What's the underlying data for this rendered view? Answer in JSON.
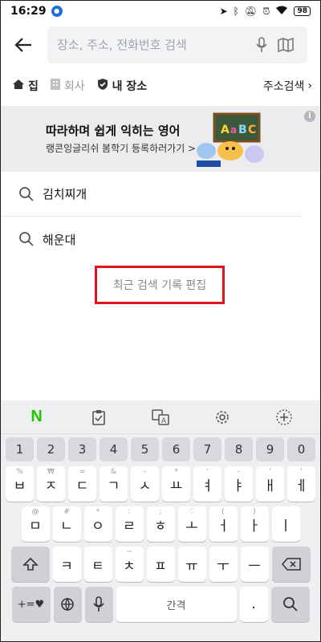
{
  "status_bar": {
    "time": "16:29",
    "battery": "98"
  },
  "search": {
    "placeholder": "장소, 주소, 전화번호 검색"
  },
  "tabs": {
    "home": "집",
    "work": "회사",
    "my_places": "내 장소",
    "address_search": "주소검색"
  },
  "ad": {
    "title": "따라하며 쉽게 익히는 영어",
    "subtitle": "랭콘잉글리쉬 봄학기 등록하러가기 >",
    "info": "i"
  },
  "recent_searches": [
    {
      "label": "김치찌개"
    },
    {
      "label": "해운대"
    }
  ],
  "edit_history_label": "최근 검색 기록 편집",
  "keyboard": {
    "number_row": [
      "1",
      "2",
      "3",
      "4",
      "5",
      "6",
      "7",
      "8",
      "9",
      "0"
    ],
    "row1": [
      {
        "key": "ㅂ",
        "sup": "%"
      },
      {
        "key": "ㅈ",
        "sup": "₩"
      },
      {
        "key": "ㄷ",
        "sup": "="
      },
      {
        "key": "ㄱ",
        "sup": "&"
      },
      {
        "key": "ㅅ",
        "sup": "-"
      },
      {
        "key": "ㅛ",
        "sup": "*"
      },
      {
        "key": "ㅕ",
        "sup": "'"
      },
      {
        "key": "ㅑ",
        "sup": "-"
      },
      {
        "key": "ㅐ",
        "sup": "'"
      },
      {
        "key": "ㅔ",
        "sup": "'"
      }
    ],
    "row2": [
      {
        "key": "ㅁ",
        "sup": "@"
      },
      {
        "key": "ㄴ",
        "sup": "#"
      },
      {
        "key": "ㅇ",
        "sup": "*"
      },
      {
        "key": "ㄹ",
        "sup": ":"
      },
      {
        "key": "ㅎ",
        "sup": ";"
      },
      {
        "key": "ㅗ",
        "sup": "♡"
      },
      {
        "key": "ㅓ",
        "sup": "("
      },
      {
        "key": "ㅏ",
        "sup": ")"
      },
      {
        "key": "ㅣ",
        "sup": ""
      }
    ],
    "row3": [
      {
        "key": "ㅋ",
        "sup": ""
      },
      {
        "key": "ㅌ",
        "sup": ""
      },
      {
        "key": "ㅊ",
        "sup": "~"
      },
      {
        "key": "ㅍ",
        "sup": ""
      },
      {
        "key": "ㅠ",
        "sup": ""
      },
      {
        "key": "ㅜ",
        "sup": ""
      },
      {
        "key": "ㅡ",
        "sup": ""
      }
    ],
    "symbols_label": "+=♥",
    "space_label": "간격",
    "period_label": "."
  },
  "colors": {
    "highlight_border": "#e0141c",
    "naver_green": "#1ec800"
  }
}
